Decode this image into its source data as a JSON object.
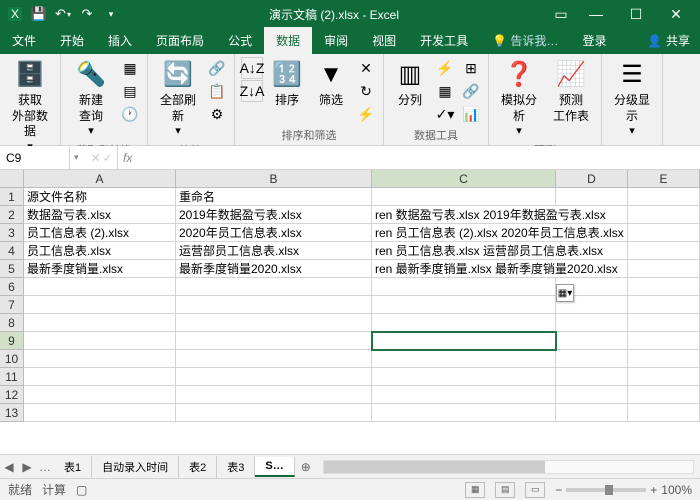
{
  "titlebar": {
    "title": "演示文稿 (2).xlsx - Excel"
  },
  "tabs": {
    "file": "文件",
    "home": "开始",
    "insert": "插入",
    "layout": "页面布局",
    "formulas": "公式",
    "data": "数据",
    "review": "审阅",
    "view": "视图",
    "dev": "开发工具",
    "tell": "告诉我…",
    "login": "登录",
    "share": "共享"
  },
  "ribbon": {
    "g1": {
      "btn1": "获取\n外部数据",
      "label": ""
    },
    "g2": {
      "btn1": "新建\n查询",
      "label": "获取和转换"
    },
    "g3": {
      "btn1": "全部刷新",
      "label": "连接"
    },
    "g4": {
      "btn1": "排序",
      "btn2": "筛选",
      "label": "排序和筛选"
    },
    "g5": {
      "btn1": "分列",
      "label": "数据工具"
    },
    "g6": {
      "btn1": "模拟分析",
      "btn2": "预测\n工作表",
      "label": "预测"
    },
    "g7": {
      "btn1": "分级显示",
      "label": ""
    }
  },
  "namebox": "C9",
  "headers": {
    "A": "A",
    "B": "B",
    "C": "C",
    "D": "D",
    "E": "E"
  },
  "rows": {
    "1": {
      "A": "源文件名称",
      "B": "重命名",
      "C": ""
    },
    "2": {
      "A": "数据盈亏表.xlsx",
      "B": "2019年数据盈亏表.xlsx",
      "C": "ren 数据盈亏表.xlsx 2019年数据盈亏表.xlsx"
    },
    "3": {
      "A": "员工信息表 (2).xlsx",
      "B": "2020年员工信息表.xlsx",
      "C": "ren 员工信息表 (2).xlsx 2020年员工信息表.xlsx"
    },
    "4": {
      "A": "员工信息表.xlsx",
      "B": "运营部员工信息表.xlsx",
      "C": "ren 员工信息表.xlsx 运营部员工信息表.xlsx"
    },
    "5": {
      "A": "最新季度销量.xlsx",
      "B": "最新季度销量2020.xlsx",
      "C": "ren 最新季度销量.xlsx 最新季度销量2020.xlsx"
    }
  },
  "sheets": {
    "s1": "表1",
    "s2": "自动录入时间",
    "s3": "表2",
    "s4": "表3",
    "s5": "S…"
  },
  "status": {
    "ready": "就绪",
    "calc": "计算",
    "zoom": "100%"
  }
}
